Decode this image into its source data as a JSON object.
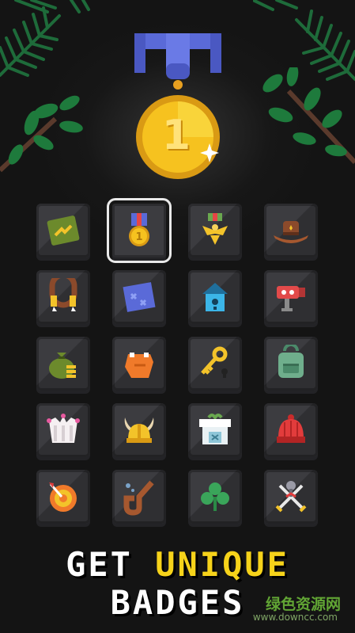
{
  "headline": {
    "line1_word1": "GET",
    "line1_word2": "UNIQUE",
    "line2": "BADGES"
  },
  "medal": {
    "number": "1"
  },
  "watermark": {
    "name": "绿色资源网",
    "url": "www.downcc.com"
  },
  "colors": {
    "background": "#141414",
    "accent": "#f6d31a",
    "badge_tile": "#3c3c40"
  },
  "badges": [
    {
      "icon": "green-ticket-icon",
      "selected": false
    },
    {
      "icon": "gold-medal-icon",
      "selected": true
    },
    {
      "icon": "eagle-medal-icon",
      "selected": false
    },
    {
      "icon": "cowboy-hat-icon",
      "selected": false
    },
    {
      "icon": "horseshoe-magnet-icon",
      "selected": false
    },
    {
      "icon": "treasure-map-icon",
      "selected": false
    },
    {
      "icon": "birdhouse-icon",
      "selected": false
    },
    {
      "icon": "robot-camera-icon",
      "selected": false
    },
    {
      "icon": "money-bag-icon",
      "selected": false
    },
    {
      "icon": "orange-glove-icon",
      "selected": false
    },
    {
      "icon": "key-lock-icon",
      "selected": false
    },
    {
      "icon": "backpack-icon",
      "selected": false
    },
    {
      "icon": "jester-crown-icon",
      "selected": false
    },
    {
      "icon": "viking-helmet-icon",
      "selected": false
    },
    {
      "icon": "shop-stall-icon",
      "selected": false
    },
    {
      "icon": "red-beanie-icon",
      "selected": false
    },
    {
      "icon": "target-icon",
      "selected": false
    },
    {
      "icon": "smoking-pipe-icon",
      "selected": false
    },
    {
      "icon": "clover-icon",
      "selected": false
    },
    {
      "icon": "crossed-swords-icon",
      "selected": false
    }
  ]
}
